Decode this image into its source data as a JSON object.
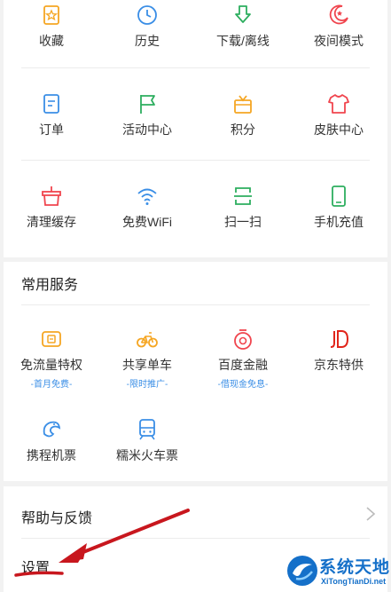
{
  "grid": [
    {
      "label": "收藏",
      "icon": "star-bookmark-icon",
      "color": "#f5a623"
    },
    {
      "label": "历史",
      "icon": "clock-icon",
      "color": "#3a8ee6"
    },
    {
      "label": "下载/离线",
      "icon": "download-arrow-icon",
      "color": "#2dae5f"
    },
    {
      "label": "夜间模式",
      "icon": "moon-icon",
      "color": "#f0454e"
    },
    {
      "label": "订单",
      "icon": "order-list-icon",
      "color": "#3a8ee6"
    },
    {
      "label": "活动中心",
      "icon": "flag-icon",
      "color": "#2dae5f"
    },
    {
      "label": "积分",
      "icon": "gift-box-icon",
      "color": "#f5a623"
    },
    {
      "label": "皮肤中心",
      "icon": "tshirt-icon",
      "color": "#f0454e"
    },
    {
      "label": "清理缓存",
      "icon": "broom-basket-icon",
      "color": "#f0454e"
    },
    {
      "label": "免费WiFi",
      "icon": "wifi-icon",
      "color": "#3a8ee6"
    },
    {
      "label": "扫一扫",
      "icon": "scan-icon",
      "color": "#2dae5f"
    },
    {
      "label": "手机充值",
      "icon": "phone-icon",
      "color": "#2dae5f"
    }
  ],
  "services": {
    "title": "常用服务",
    "items": [
      {
        "label": "免流量特权",
        "sub": "-首月免费-",
        "icon": "data-card-icon",
        "color": "#f5a623"
      },
      {
        "label": "共享单车",
        "sub": "-限时推广-",
        "icon": "bicycle-icon",
        "color": "#f5a623"
      },
      {
        "label": "百度金融",
        "sub": "-借现金免息-",
        "icon": "finance-icon",
        "color": "#f0454e"
      },
      {
        "label": "京东特供",
        "sub": "",
        "icon": "jd-logo-icon",
        "color": "#e1251b"
      },
      {
        "label": "携程机票",
        "sub": "",
        "icon": "ctrip-dolphin-icon",
        "color": "#3a8ee6"
      },
      {
        "label": "糯米火车票",
        "sub": "",
        "icon": "train-icon",
        "color": "#3a8ee6"
      }
    ]
  },
  "menu": {
    "help_label": "帮助与反馈",
    "settings_label": "设置"
  },
  "annotation": {
    "arrow_color": "#c8171e"
  },
  "watermark": {
    "title": "系统天地",
    "url": "XiTongTianDi.net"
  }
}
